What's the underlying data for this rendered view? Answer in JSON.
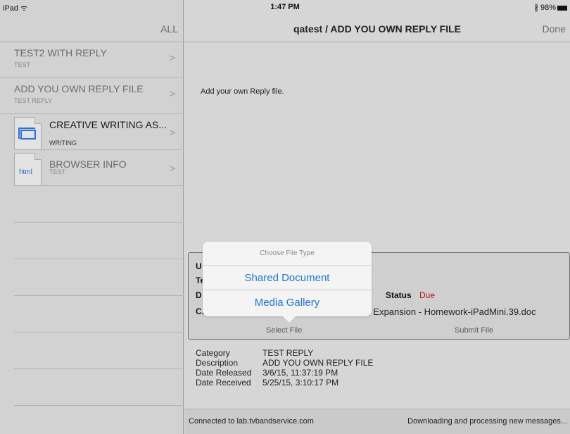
{
  "status_bar": {
    "device": "iPad",
    "wifi": "ᯤ",
    "time": "1:47 PM",
    "bluetooth": "∦",
    "battery": "98%"
  },
  "sidebar": {
    "all_label": "ALL",
    "items": [
      {
        "title": "TEST2 WITH REPLY",
        "subtitle": "TEST",
        "chevron": ">"
      },
      {
        "title": "ADD YOU OWN REPLY FILE",
        "subtitle": "TEST REPLY",
        "chevron": ">"
      },
      {
        "title": "CREATIVE WRITING AS...",
        "subtitle": "WRITING",
        "chevron": ">",
        "icon": "window-icon"
      },
      {
        "title": "BROWSER INFO",
        "subtitle": "TEST",
        "chevron": ">",
        "icon": "html-file-icon",
        "icon_text": "html"
      }
    ]
  },
  "main": {
    "title": "qatest / ADD YOU OWN REPLY FILE",
    "done_label": "Done",
    "description": "Add your own Reply file.",
    "panel": {
      "label_u": "U",
      "label_t": "Te",
      "label_d": "D",
      "label_c": "C.",
      "status_label": "Status",
      "status_value": "Due",
      "filename": "ard Expansion - Homework-iPadMini.39.doc",
      "select_file": "Select File",
      "submit_file": "Submit File"
    },
    "details": {
      "category_label": "Category",
      "category_value": "TEST REPLY",
      "description_label": "Description",
      "description_value": "ADD YOU OWN REPLY FILE",
      "released_label": "Date Released",
      "released_value": "3/6/15, 11:37:19 PM",
      "received_label": "Date Received",
      "received_value": "5/25/15, 3:10:17 PM"
    },
    "footer": {
      "connection": "Connected to lab.tvbandservice.com",
      "activity": "Downloading and processing new messages..."
    }
  },
  "popover": {
    "header": "Choose File Type",
    "options": [
      "Shared Document",
      "Media Gallery"
    ]
  },
  "colors": {
    "link": "#1f74d8",
    "status_due": "#b51a1a",
    "background": "#d6d6d6"
  }
}
